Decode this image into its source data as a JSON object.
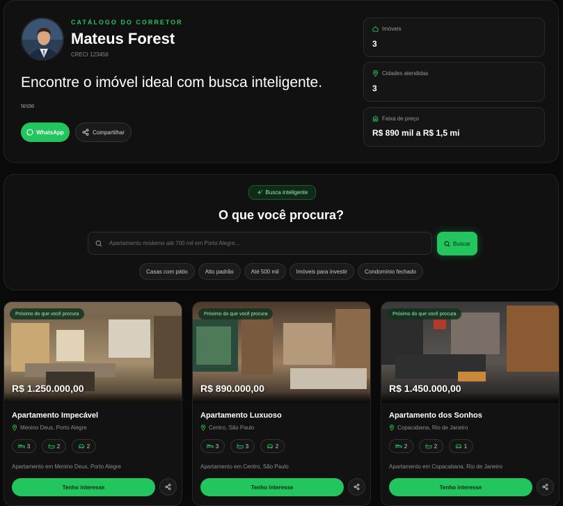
{
  "profile": {
    "eyebrow": "CATÁLOGO DO CORRETOR",
    "name": "Mateus Forest",
    "creci": "CRECI 123456",
    "headline": "Encontre o imóvel ideal com busca inteligente.",
    "description": "teste",
    "whatsapp_label": "WhatsApp",
    "share_label": "Compartilhar"
  },
  "stats": [
    {
      "label": "Imóveis",
      "value": "3",
      "icon": "home-icon"
    },
    {
      "label": "Cidades atendidas",
      "value": "3",
      "icon": "map-pin-icon"
    },
    {
      "label": "Faixa de preço",
      "value": "R$ 890 mil a R$ 1,5 mi",
      "icon": "building-icon"
    }
  ],
  "search": {
    "badge": "Busca inteligente",
    "title": "O que você procura?",
    "placeholder": "Apartamento moderno até 700 mil em Porto Alegre...",
    "button": "Buscar",
    "chips": [
      "Casas com pátio",
      "Alto padrão",
      "Até 500 mil",
      "Imóveis para investir",
      "Condomínio fechado"
    ]
  },
  "listings": [
    {
      "tag": "Próximo do que você procura",
      "price": "R$ 1.250.000,00",
      "title": "Apartamento Impecável",
      "location": "Menino Deus, Porto Alegre",
      "beds": "3",
      "baths": "2",
      "parking": "2",
      "description": "Apartamento em Menino Deus, Porto Alegre",
      "button": "Tenho interesse"
    },
    {
      "tag": "Próximo do que você procura",
      "price": "R$ 890.000,00",
      "title": "Apartamento Luxuoso",
      "location": "Centro, São Paulo",
      "beds": "3",
      "baths": "3",
      "parking": "2",
      "description": "Apartamento em Centro, São Paulo",
      "button": "Tenho interesse"
    },
    {
      "tag": "Próximo do que você procura",
      "price": "R$ 1.450.000,00",
      "title": "Apartamento dos Sonhos",
      "location": "Copacabana, Rio de Janeiro",
      "beds": "2",
      "baths": "2",
      "parking": "1",
      "description": "Apartamento em Copacabana, Rio de Janeiro",
      "button": "Tenho interesse"
    }
  ],
  "colors": {
    "accent": "#22c55e",
    "background": "#0a0a0a",
    "card": "#111111"
  }
}
